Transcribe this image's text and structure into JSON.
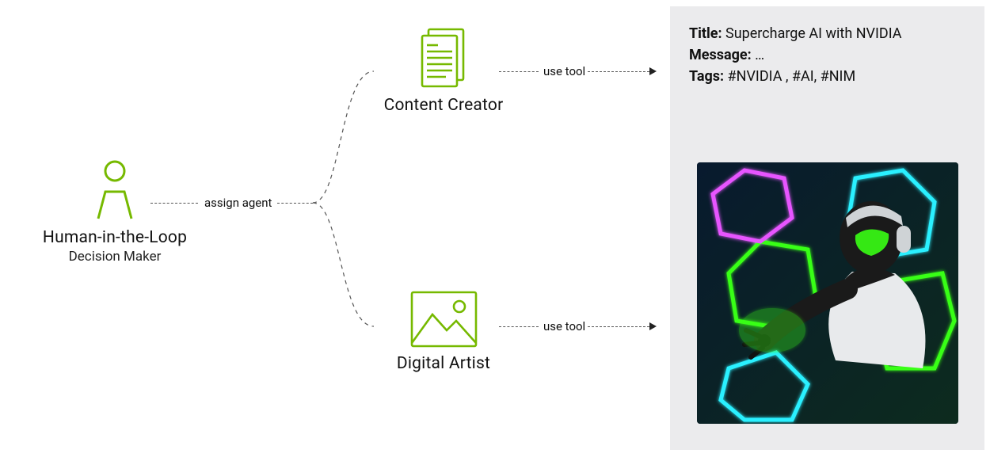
{
  "nodes": {
    "human": {
      "title": "Human-in-the-Loop",
      "subtitle": "Decision Maker",
      "icon": "person-icon"
    },
    "content_creator": {
      "title": "Content Creator",
      "icon": "document-icon"
    },
    "digital_artist": {
      "title": "Digital Artist",
      "icon": "picture-icon"
    }
  },
  "edges": {
    "assign": {
      "label": "assign agent"
    },
    "tool_top": {
      "label": "use tool"
    },
    "tool_bottom": {
      "label": "use tool"
    }
  },
  "result": {
    "title_label": "Title:",
    "title_value": "Supercharge AI with NVIDIA",
    "message_label": "Message:",
    "message_value": "…",
    "tags_label": "Tags:",
    "tags_value": "#NVIDIA , #AI, #NIM",
    "image_alt": "Neon futuristic robot interacting with holographic panels"
  },
  "colors": {
    "accent": "#76b900",
    "panel_bg": "#ebebed"
  }
}
